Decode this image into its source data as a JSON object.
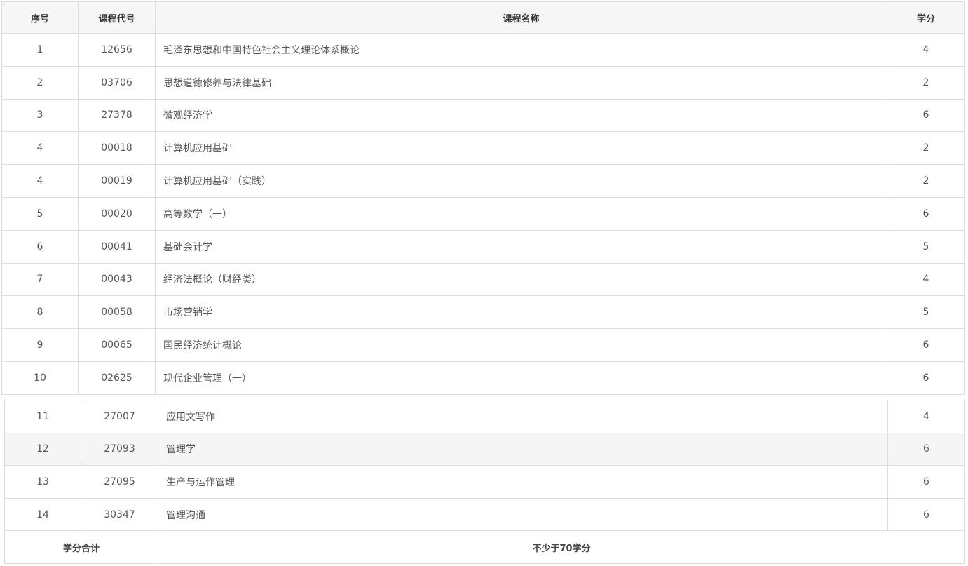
{
  "headers": {
    "seq": "序号",
    "code": "课程代号",
    "name": "课程名称",
    "credit": "学分"
  },
  "courses": [
    {
      "seq": "1",
      "code": "12656",
      "name": "毛泽东思想和中国特色社会主义理论体系概论",
      "credit": "4"
    },
    {
      "seq": "2",
      "code": "03706",
      "name": "思想道德修养与法律基础",
      "credit": "2"
    },
    {
      "seq": "3",
      "code": "27378",
      "name": "微观经济学",
      "credit": "6"
    },
    {
      "seq": "4",
      "code": "00018",
      "name": "计算机应用基础",
      "credit": "2"
    },
    {
      "seq": "4",
      "code": "00019",
      "name": "计算机应用基础（实践）",
      "credit": "2"
    },
    {
      "seq": "5",
      "code": "00020",
      "name": "高等数学（一）",
      "credit": "6"
    },
    {
      "seq": "6",
      "code": "00041",
      "name": "基础会计学",
      "credit": "5"
    },
    {
      "seq": "7",
      "code": "00043",
      "name": "经济法概论（财经类）",
      "credit": "4"
    },
    {
      "seq": "8",
      "code": "00058",
      "name": "市场营销学",
      "credit": "5"
    },
    {
      "seq": "9",
      "code": "00065",
      "name": "国民经济统计概论",
      "credit": "6"
    },
    {
      "seq": "10",
      "code": "02625",
      "name": "现代企业管理（一）",
      "credit": "6"
    },
    {
      "seq": "11",
      "code": "27007",
      "name": "应用文写作",
      "credit": "4"
    },
    {
      "seq": "12",
      "code": "27093",
      "name": "管理学",
      "credit": "6"
    },
    {
      "seq": "13",
      "code": "27095",
      "name": "生产与运作管理",
      "credit": "6"
    },
    {
      "seq": "14",
      "code": "30347",
      "name": "管理沟通",
      "credit": "6"
    }
  ],
  "total": {
    "label": "学分合计",
    "value": "不少于70学分"
  }
}
